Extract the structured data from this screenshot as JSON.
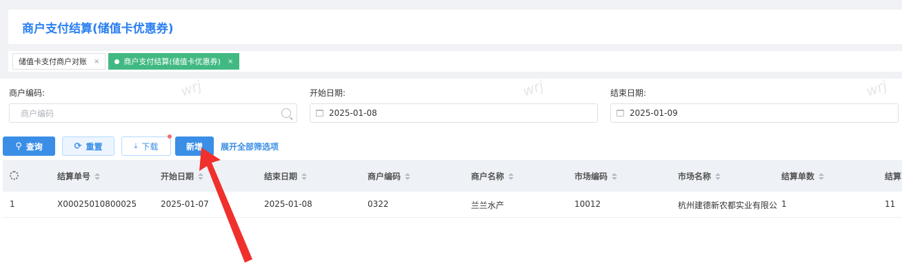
{
  "page_title": "商户支付结算(储值卡优惠券)",
  "tabs": [
    {
      "label": "储值卡支付商户对账",
      "close": "×"
    },
    {
      "label": "商户支付结算(储值卡优惠券)",
      "close": "×"
    }
  ],
  "filters": {
    "merchant_code": {
      "label": "商户编码:",
      "placeholder": "商户编码"
    },
    "start_date": {
      "label": "开始日期:",
      "value": "2025-01-08"
    },
    "end_date": {
      "label": "结束日期:",
      "value": "2025-01-09"
    }
  },
  "buttons": {
    "query": "查询",
    "reset": "重置",
    "download": "下载",
    "add": "新增",
    "expand": "展开全部筛选项"
  },
  "table": {
    "columns": [
      "结算单号",
      "开始日期",
      "结束日期",
      "商户编码",
      "商户名称",
      "市场编码",
      "市场名称",
      "结算单数",
      "结算"
    ],
    "rows": [
      {
        "index": "1",
        "cells": [
          "X00025010800025",
          "2025-01-07",
          "2025-01-08",
          "0322",
          "兰兰水产",
          "10012",
          "杭州建德新农都实业有限公",
          "1",
          "11"
        ]
      }
    ]
  },
  "watermark": "wrj",
  "colors": {
    "primary": "#3a8ee6",
    "active_tab": "#42b983",
    "title": "#2a7ff0",
    "arrow": "#f0302c"
  },
  "icons": [
    "search-icon",
    "calendar-icon",
    "refresh-icon",
    "download-icon",
    "gear-icon",
    "sort-icon",
    "close-icon"
  ]
}
